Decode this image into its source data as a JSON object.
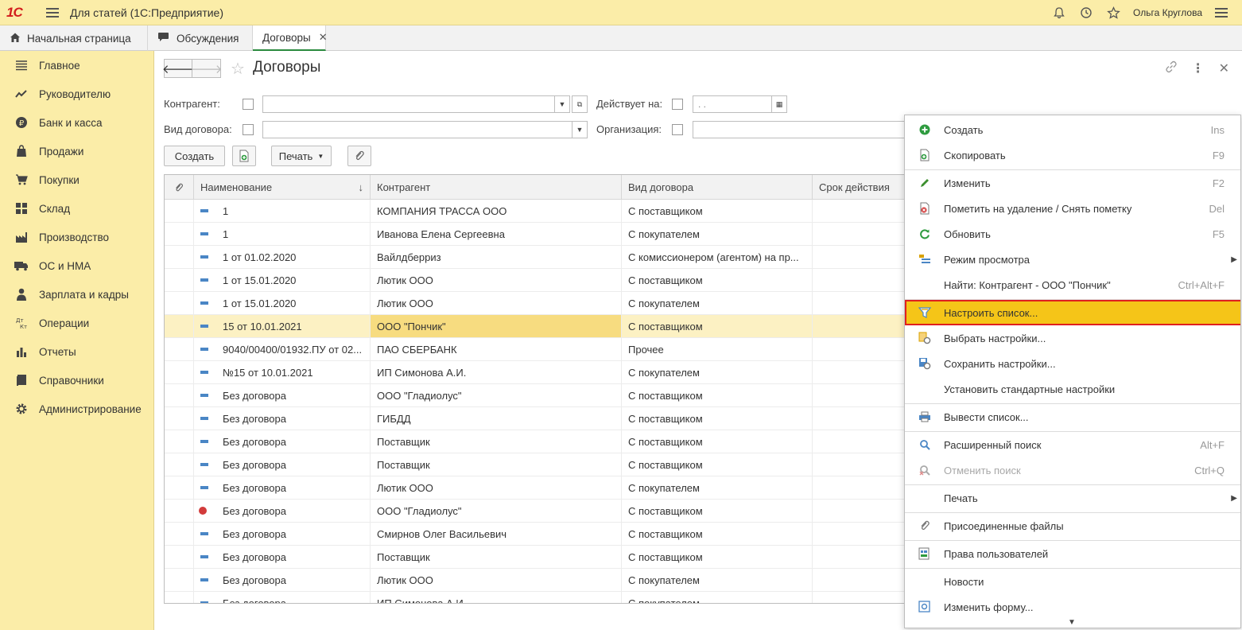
{
  "app": {
    "logo": "1С",
    "title": "Для статей  (1С:Предприятие)",
    "user": "Ольга Круглова"
  },
  "tabs": [
    {
      "label": "Начальная страница",
      "icon": "home-icon"
    },
    {
      "label": "Обсуждения",
      "icon": "chat-icon"
    },
    {
      "label": "Договоры",
      "icon": "",
      "active": true,
      "closable": true
    }
  ],
  "sidebar": {
    "items": [
      {
        "label": "Главное",
        "icon": "menu-lines-icon"
      },
      {
        "label": "Руководителю",
        "icon": "trend-icon"
      },
      {
        "label": "Банк и касса",
        "icon": "ruble-icon"
      },
      {
        "label": "Продажи",
        "icon": "bag-icon"
      },
      {
        "label": "Покупки",
        "icon": "cart-icon"
      },
      {
        "label": "Склад",
        "icon": "grid-icon"
      },
      {
        "label": "Производство",
        "icon": "factory-icon"
      },
      {
        "label": "ОС и НМА",
        "icon": "truck-icon"
      },
      {
        "label": "Зарплата и кадры",
        "icon": "person-icon"
      },
      {
        "label": "Операции",
        "icon": "dt-kt-icon"
      },
      {
        "label": "Отчеты",
        "icon": "bar-chart-icon"
      },
      {
        "label": "Справочники",
        "icon": "book-icon"
      },
      {
        "label": "Администрирование",
        "icon": "gear-icon"
      }
    ]
  },
  "page": {
    "title": "Договоры"
  },
  "filters": {
    "kontragent_label": "Контрагент:",
    "vid_label": "Вид договора:",
    "deistvuet_label": "Действует на:",
    "deistvuet_value": " .  .",
    "org_label": "Организация:"
  },
  "toolbar": {
    "create_label": "Создать",
    "print_label": "Печать"
  },
  "table": {
    "columns": [
      "Наименование",
      "Контрагент",
      "Вид договора",
      "Срок действия"
    ],
    "rows": [
      {
        "name": "1",
        "kontragent": "КОМПАНИЯ ТРАССА ООО",
        "vid": "С поставщиком"
      },
      {
        "name": "1",
        "kontragent": "Иванова Елена Сергеевна",
        "vid": "С покупателем"
      },
      {
        "name": "1 от 01.02.2020",
        "kontragent": "Вайлдберриз",
        "vid": "С комиссионером (агентом) на пр..."
      },
      {
        "name": "1 от 15.01.2020",
        "kontragent": "Лютик ООО",
        "vid": "С поставщиком"
      },
      {
        "name": "1 от 15.01.2020",
        "kontragent": "Лютик ООО",
        "vid": "С покупателем"
      },
      {
        "name": "15 от 10.01.2021",
        "kontragent": "ООО \"Пончик\"",
        "vid": "С поставщиком",
        "selected": true
      },
      {
        "name": "9040/00400/01932.ПУ от 02...",
        "kontragent": "ПАО СБЕРБАНК",
        "vid": "Прочее"
      },
      {
        "name": "№15 от 10.01.2021",
        "kontragent": "ИП Симонова А.И.",
        "vid": "С покупателем"
      },
      {
        "name": "Без договора",
        "kontragent": "ООО \"Гладиолус\"",
        "vid": "С поставщиком"
      },
      {
        "name": "Без договора",
        "kontragent": "ГИБДД",
        "vid": "С поставщиком"
      },
      {
        "name": "Без договора",
        "kontragent": "Поставщик",
        "vid": "С поставщиком"
      },
      {
        "name": "Без договора",
        "kontragent": "Поставщик",
        "vid": "С поставщиком"
      },
      {
        "name": "Без договора",
        "kontragent": "Лютик ООО",
        "vid": "С покупателем"
      },
      {
        "name": "Без договора",
        "kontragent": "ООО \"Гладиолус\"",
        "vid": "С поставщиком",
        "deleted": true
      },
      {
        "name": "Без договора",
        "kontragent": "Смирнов Олег Васильевич",
        "vid": "С поставщиком"
      },
      {
        "name": "Без договора",
        "kontragent": "Поставщик",
        "vid": "С поставщиком"
      },
      {
        "name": "Без договора",
        "kontragent": "Лютик ООО",
        "vid": "С покупателем"
      },
      {
        "name": "Без договора",
        "kontragent": "ИП Симонова А.И.",
        "vid": "С покупателем"
      }
    ]
  },
  "context_menu": {
    "items": [
      {
        "label": "Создать",
        "key": "Ins",
        "icon": "plus-circle-icon",
        "color": "#2e9b3f"
      },
      {
        "label": "Скопировать",
        "key": "F9",
        "icon": "copy-icon",
        "color": "#2e9b3f"
      },
      {
        "label": "Изменить",
        "key": "F2",
        "icon": "pencil-icon",
        "color": "#3c8f2f"
      },
      {
        "label": "Пометить на удаление / Снять пометку",
        "key": "Del",
        "icon": "delete-mark-icon",
        "color": "#d23b3b"
      },
      {
        "label": "Обновить",
        "key": "F5",
        "icon": "refresh-icon",
        "color": "#2e9b3f"
      },
      {
        "label": "Режим просмотра",
        "key": "",
        "icon": "view-mode-icon",
        "color": "#d9a200",
        "submenu": true
      },
      {
        "label": "Найти: Контрагент - ООО \"Пончик\"",
        "key": "Ctrl+Alt+F",
        "icon": "",
        "color": ""
      },
      {
        "label": "Настроить список...",
        "key": "",
        "icon": "list-settings-icon",
        "color": "#4a86c5",
        "highlighted": true
      },
      {
        "label": "Выбрать настройки...",
        "key": "",
        "icon": "choose-settings-icon",
        "color": "#d9a200"
      },
      {
        "label": "Сохранить настройки...",
        "key": "",
        "icon": "save-settings-icon",
        "color": "#4a86c5"
      },
      {
        "label": "Установить стандартные настройки",
        "key": "",
        "icon": "",
        "color": ""
      },
      {
        "label": "Вывести список...",
        "key": "",
        "icon": "print-list-icon",
        "color": "#4a86c5"
      },
      {
        "label": "Расширенный поиск",
        "key": "Alt+F",
        "icon": "search-icon",
        "color": "#4a86c5"
      },
      {
        "label": "Отменить поиск",
        "key": "Ctrl+Q",
        "icon": "cancel-search-icon",
        "color": "#aaaaaa",
        "disabled": true
      },
      {
        "label": "Печать",
        "key": "",
        "icon": "",
        "color": "",
        "submenu": true
      },
      {
        "label": "Присоединенные файлы",
        "key": "",
        "icon": "paperclip-icon",
        "color": "#777777"
      },
      {
        "label": "Права пользователей",
        "key": "",
        "icon": "user-rights-icon",
        "color": "#4a86c5"
      },
      {
        "label": "Новости",
        "key": "",
        "icon": "",
        "color": ""
      },
      {
        "label": "Изменить форму...",
        "key": "",
        "icon": "edit-form-icon",
        "color": "#4a86c5"
      }
    ]
  },
  "colors": {
    "sidebar_bg": "#fbeda8",
    "highlight": "#f5c518",
    "highlight_border": "#e0201e",
    "selected_row": "#fcf1c3"
  }
}
